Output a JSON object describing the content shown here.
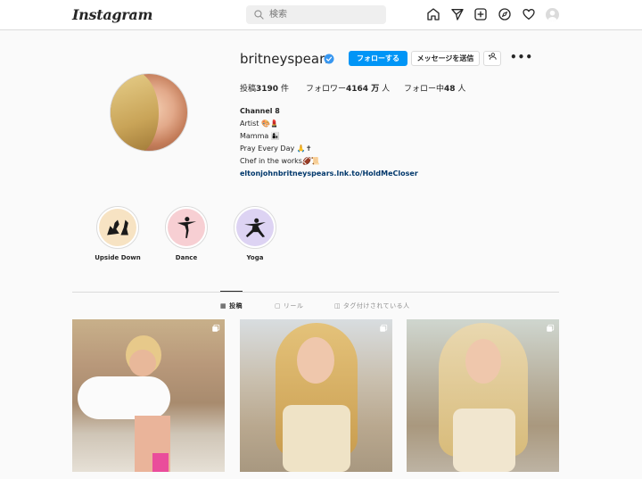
{
  "header": {
    "logo": "Instagram",
    "search_placeholder": "検索"
  },
  "profile": {
    "username": "britneyspears",
    "follow_label": "フォローする",
    "message_label": "メッセージを送信",
    "suggest_label": "+Ձ",
    "more_label": "•••",
    "stats": {
      "posts_prefix": "投稿",
      "posts_value": "3190",
      "posts_suffix": "件",
      "followers_prefix": "フォロワー",
      "followers_value": "4164 万",
      "followers_suffix": "人",
      "following_prefix": "フォロー中",
      "following_value": "48",
      "following_suffix": "人"
    },
    "bio": {
      "name": "Channel 8",
      "line1": "Artist 🎨💄",
      "line2": "Mamma 👩‍👦",
      "line3": "Pray Every Day 🙏✝",
      "line4": "Chef in the works🏈📜",
      "link": "eltonjohnbritneyspears.lnk.to/HoldMeCloser"
    }
  },
  "highlights": [
    {
      "label": "Upside Down",
      "bg": "#f7e3c3"
    },
    {
      "label": "Dance",
      "bg": "#f7cfd3"
    },
    {
      "label": "Yoga",
      "bg": "#ddd3f3"
    }
  ],
  "tabs": {
    "posts": "投稿",
    "reels": "リール",
    "tagged": "タグ付けされている人"
  },
  "colors": {
    "accent": "#0095f6",
    "link": "#00376b",
    "verified": "#3897f0"
  }
}
